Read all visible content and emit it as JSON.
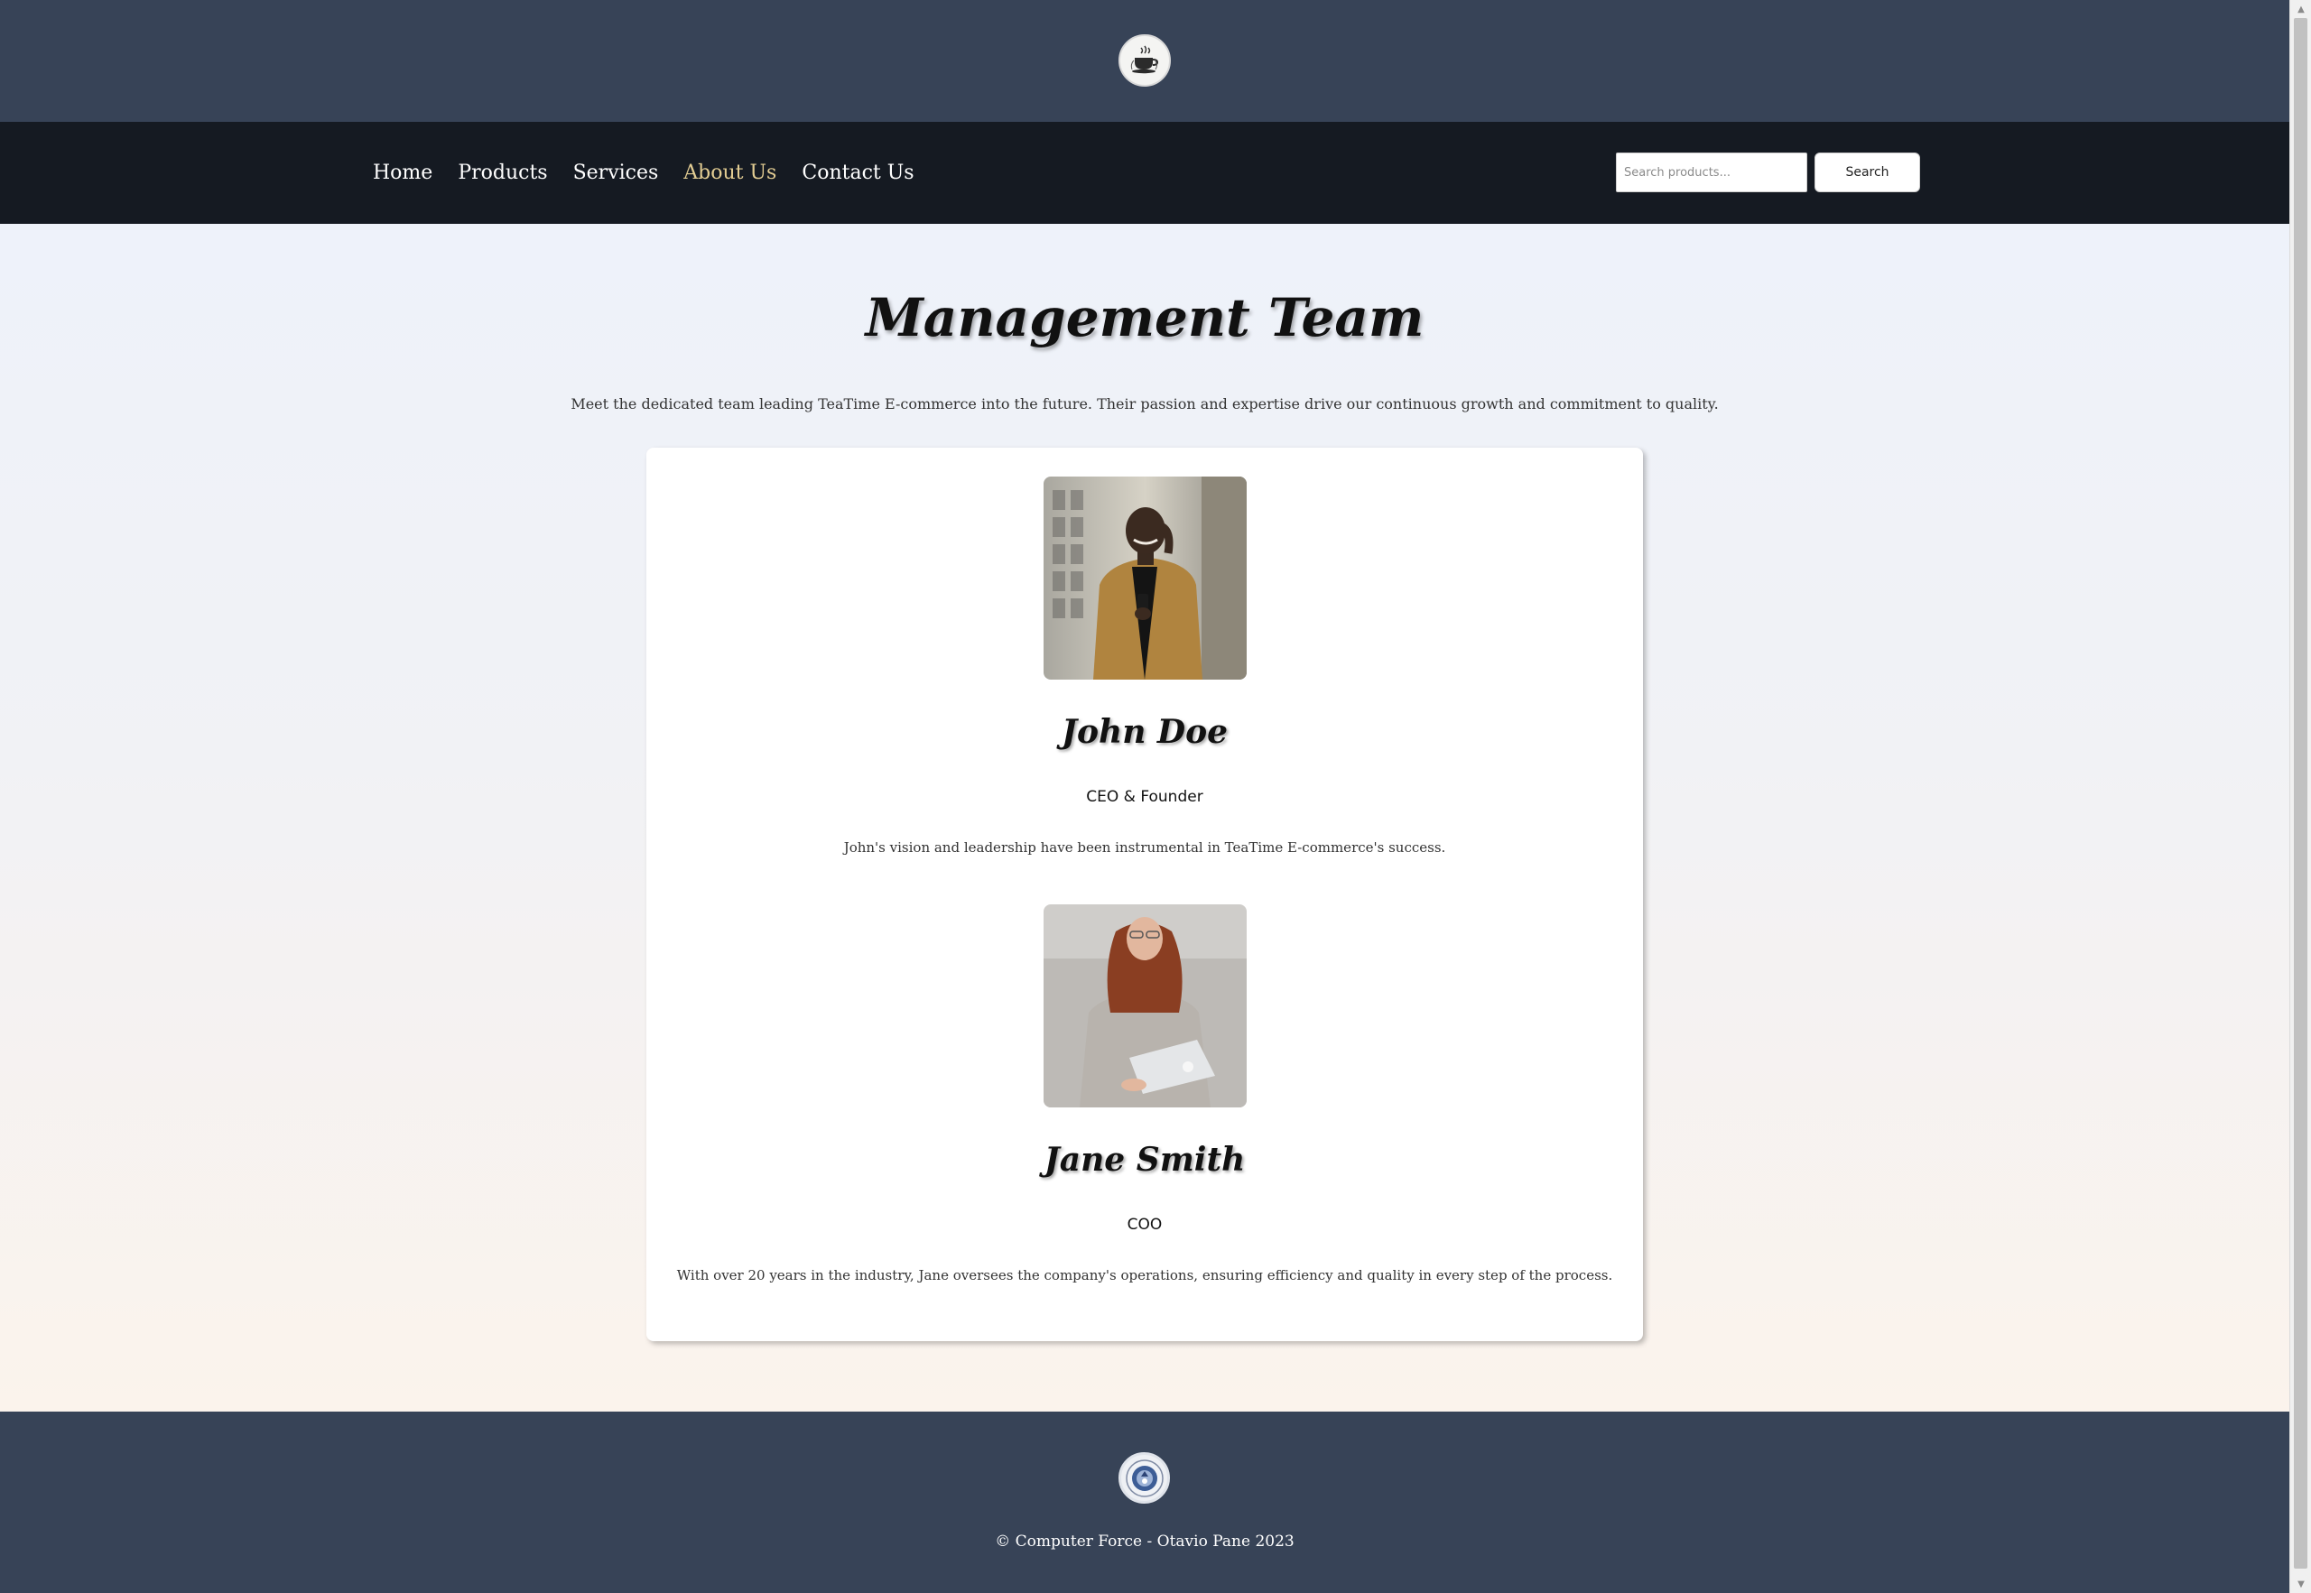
{
  "header": {
    "logo_icon": "teacup-logo-icon"
  },
  "nav": {
    "items": [
      {
        "label": "Home",
        "active": false
      },
      {
        "label": "Products",
        "active": false
      },
      {
        "label": "Services",
        "active": false
      },
      {
        "label": "About Us",
        "active": true
      },
      {
        "label": "Contact Us",
        "active": false
      }
    ],
    "search_placeholder": "Search products...",
    "search_value": "",
    "search_button": "Search",
    "active_color": "#e3cd93"
  },
  "main": {
    "title": "Management Team",
    "intro": "Meet the dedicated team leading TeaTime E-commerce into the future. Their passion and expertise drive our continuous growth and commitment to quality.",
    "members": [
      {
        "name": "John Doe",
        "role": "CEO & Founder",
        "bio": "John's vision and leadership have been instrumental in TeaTime E-commerce's success."
      },
      {
        "name": "Jane Smith",
        "role": "COO",
        "bio": "With over 20 years in the industry, Jane oversees the company's operations, ensuring efficiency and quality in every step of the process."
      }
    ]
  },
  "footer": {
    "logo_icon": "seal-logo-icon",
    "copyright": "© Computer Force - Otavio Pane 2023"
  },
  "colors": {
    "topbar": "#374357",
    "navbar": "#151a22",
    "footer": "#374357"
  }
}
